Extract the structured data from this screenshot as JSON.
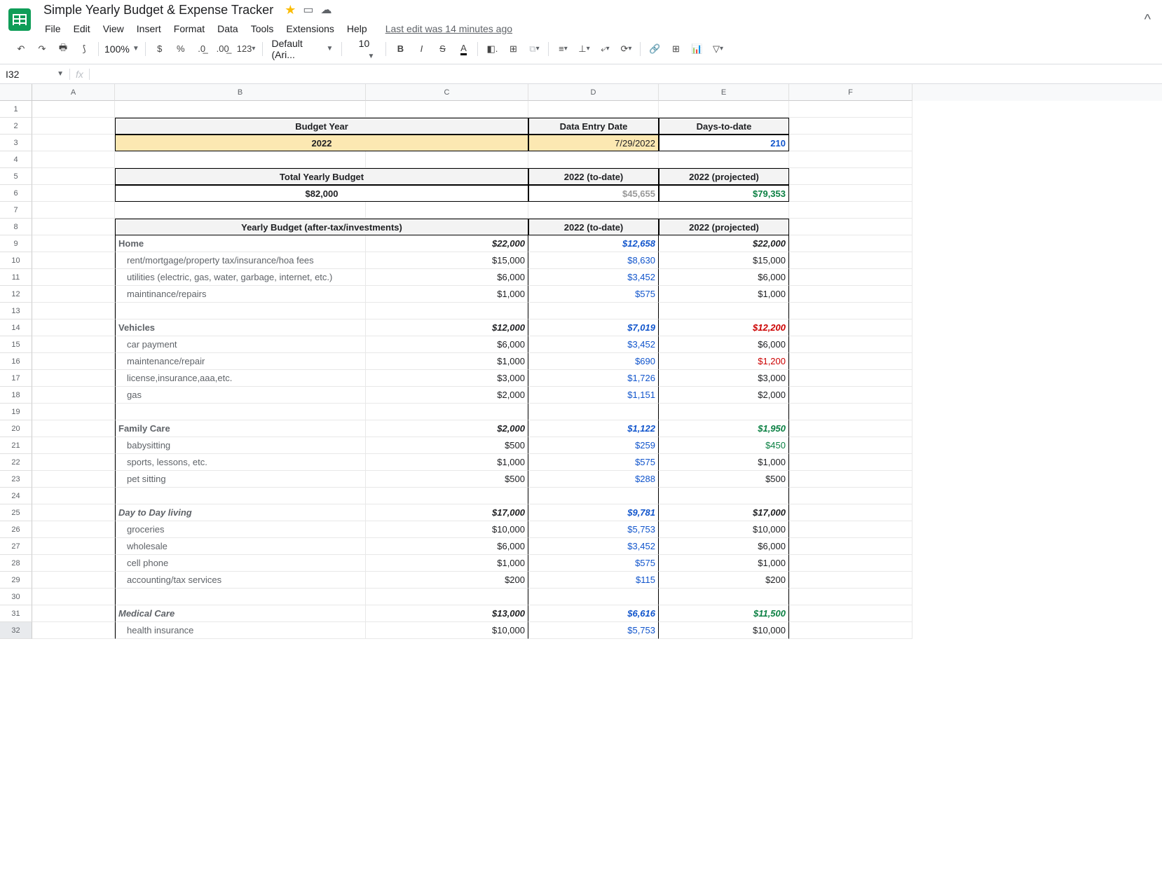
{
  "doc": {
    "title": "Simple Yearly Budget & Expense Tracker",
    "lastEdit": "Last edit was 14 minutes ago"
  },
  "menus": [
    "File",
    "Edit",
    "View",
    "Insert",
    "Format",
    "Data",
    "Tools",
    "Extensions",
    "Help"
  ],
  "toolbar": {
    "zoom": "100%",
    "font": "Default (Ari...",
    "size": "10"
  },
  "nameBox": "I32",
  "cols": [
    "A",
    "B",
    "C",
    "D",
    "E",
    "F"
  ],
  "headers": {
    "budgetYear": "Budget Year",
    "dataEntryDate": "Data Entry Date",
    "daysToDate": "Days-to-date",
    "year": "2022",
    "date": "7/29/2022",
    "days": "210",
    "totalBudget": "Total Yearly Budget",
    "toDate": "2022 (to-date)",
    "projected": "2022 (projected)",
    "totalBudgetVal": "$82,000",
    "toDateVal": "$45,655",
    "projectedVal": "$79,353",
    "yearlyBudget": "Yearly Budget (after-tax/investments)"
  },
  "rows": {
    "home": {
      "label": "Home",
      "budget": "$22,000",
      "todate": "$12,658",
      "proj": "$22,000"
    },
    "rent": {
      "label": "rent/mortgage/property tax/insurance/hoa fees",
      "budget": "$15,000",
      "todate": "$8,630",
      "proj": "$15,000"
    },
    "utilities": {
      "label": "utilities (electric, gas, water, garbage, internet, etc.)",
      "budget": "$6,000",
      "todate": "$3,452",
      "proj": "$6,000"
    },
    "maint": {
      "label": "maintinance/repairs",
      "budget": "$1,000",
      "todate": "$575",
      "proj": "$1,000"
    },
    "vehicles": {
      "label": "Vehicles",
      "budget": "$12,000",
      "todate": "$7,019",
      "proj": "$12,200"
    },
    "carpay": {
      "label": "car payment",
      "budget": "$6,000",
      "todate": "$3,452",
      "proj": "$6,000"
    },
    "vmaint": {
      "label": "maintenance/repair",
      "budget": "$1,000",
      "todate": "$690",
      "proj": "$1,200"
    },
    "license": {
      "label": "license,insurance,aaa,etc.",
      "budget": "$3,000",
      "todate": "$1,726",
      "proj": "$3,000"
    },
    "gas": {
      "label": "gas",
      "budget": "$2,000",
      "todate": "$1,151",
      "proj": "$2,000"
    },
    "family": {
      "label": "Family Care",
      "budget": "$2,000",
      "todate": "$1,122",
      "proj": "$1,950"
    },
    "baby": {
      "label": "babysitting",
      "budget": "$500",
      "todate": "$259",
      "proj": "$450"
    },
    "sports": {
      "label": "sports, lessons, etc.",
      "budget": "$1,000",
      "todate": "$575",
      "proj": "$1,000"
    },
    "pet": {
      "label": "pet sitting",
      "budget": "$500",
      "todate": "$288",
      "proj": "$500"
    },
    "daytoday": {
      "label": "Day to Day living",
      "budget": "$17,000",
      "todate": "$9,781",
      "proj": "$17,000"
    },
    "groceries": {
      "label": "groceries",
      "budget": "$10,000",
      "todate": "$5,753",
      "proj": "$10,000"
    },
    "wholesale": {
      "label": "wholesale",
      "budget": "$6,000",
      "todate": "$3,452",
      "proj": "$6,000"
    },
    "cell": {
      "label": "cell phone",
      "budget": "$1,000",
      "todate": "$575",
      "proj": "$1,000"
    },
    "acct": {
      "label": "accounting/tax services",
      "budget": "$200",
      "todate": "$115",
      "proj": "$200"
    },
    "medical": {
      "label": "Medical Care",
      "budget": "$13,000",
      "todate": "$6,616",
      "proj": "$11,500"
    },
    "health": {
      "label": "health insurance",
      "budget": "$10,000",
      "todate": "$5,753",
      "proj": "$10,000"
    }
  }
}
